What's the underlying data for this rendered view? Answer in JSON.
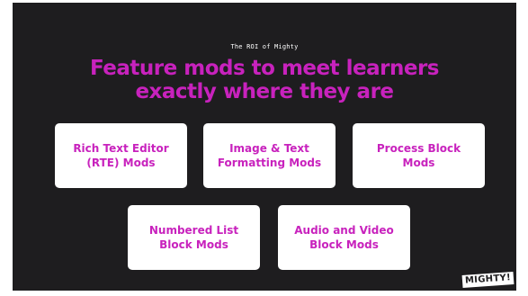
{
  "slide": {
    "eyebrow": "The ROI of Mighty",
    "headline_line1": "Feature mods to meet learners",
    "headline_line2": "exactly where they are",
    "cards": [
      {
        "line1": "Rich Text Editor",
        "line2": "(RTE) Mods"
      },
      {
        "line1": "Image & Text",
        "line2": "Formatting Mods"
      },
      {
        "line1": "Process Block",
        "line2": "Mods"
      },
      {
        "line1": "Numbered List",
        "line2": "Block Mods"
      },
      {
        "line1": "Audio and Video",
        "line2": "Block Mods"
      }
    ],
    "logo": "MIGHTY!"
  },
  "colors": {
    "background": "#1e1d1f",
    "accent": "#c822bd",
    "card": "#ffffff"
  }
}
